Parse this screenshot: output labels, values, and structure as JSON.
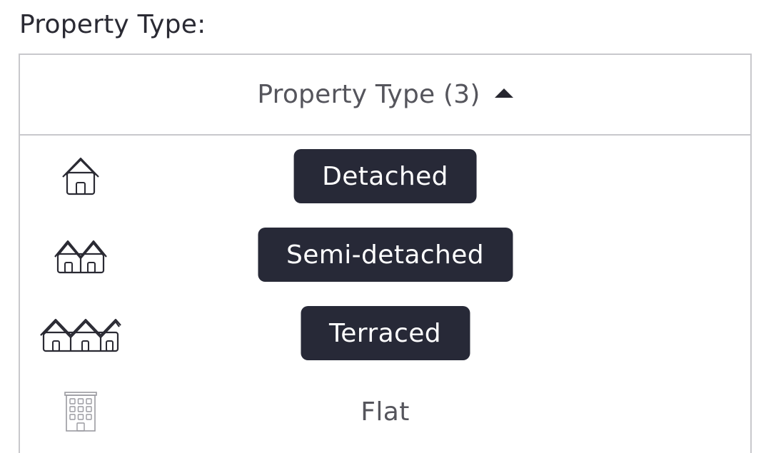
{
  "field_label": "Property Type:",
  "dropdown": {
    "header_label": "Property Type (3)",
    "caret_icon": "caret-up-icon",
    "options": [
      {
        "label": "Detached",
        "selected": true,
        "icon": "detached-house-icon"
      },
      {
        "label": "Semi-detached",
        "selected": true,
        "icon": "semi-detached-house-icon"
      },
      {
        "label": "Terraced",
        "selected": true,
        "icon": "terraced-houses-icon"
      },
      {
        "label": "Flat",
        "selected": false,
        "icon": "flat-building-icon"
      }
    ]
  },
  "colors": {
    "selected_bg": "#272937",
    "selected_text": "#ffffff",
    "unselected_text": "#55555c",
    "border": "#c8c8cc"
  }
}
